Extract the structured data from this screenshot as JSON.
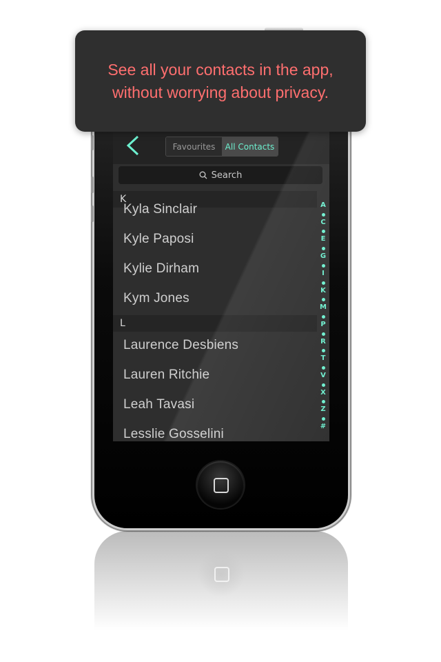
{
  "tooltip": {
    "line1": "See all your contacts in the app,",
    "line2": "without worrying about privacy."
  },
  "nav": {
    "back_icon": "chevron-left-icon",
    "segments": [
      {
        "label": "Favourites",
        "active": false
      },
      {
        "label": "All Contacts",
        "active": true
      }
    ]
  },
  "search": {
    "placeholder": "Search",
    "icon": "search-icon"
  },
  "sections": [
    {
      "header": "K",
      "contacts": [
        "Kyla Sinclair",
        "Kyle Paposi",
        "Kylie Dirham",
        "Kym Jones"
      ]
    },
    {
      "header": "L",
      "contacts": [
        "Laurence Desbiens",
        "Lauren Ritchie",
        "Leah Tavasi",
        "Lesslie Gosselini"
      ]
    }
  ],
  "index_letters": [
    "A",
    "C",
    "E",
    "G",
    "I",
    "K",
    "M",
    "P",
    "R",
    "T",
    "V",
    "X",
    "Z",
    "#"
  ],
  "colors": {
    "accent": "#6df0cf",
    "tooltip_text": "#ff6f6f",
    "tooltip_bg": "#2f2f2f"
  }
}
